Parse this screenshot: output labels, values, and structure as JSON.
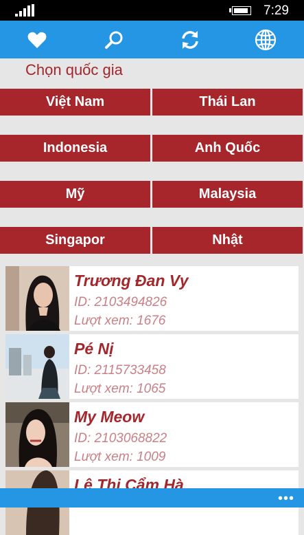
{
  "status": {
    "time": "7:29"
  },
  "appbar": {
    "icons": [
      "heart-icon",
      "search-icon",
      "refresh-icon",
      "globe-icon"
    ]
  },
  "heading": "Chọn quốc gia",
  "countries": [
    "Việt Nam",
    "Thái Lan",
    "Indonesia",
    "Anh Quốc",
    "Mỹ",
    "Malaysia",
    "Singapor",
    "Nhật"
  ],
  "profiles": [
    {
      "name": "Trương Đan Vy",
      "id": "ID:  2103494826",
      "views": "Lượt xem: 1676"
    },
    {
      "name": "Pé Nị",
      "id": "ID:  2115733458",
      "views": "Lượt xem: 1065"
    },
    {
      "name": "My Meow",
      "id": "ID:  2103068822",
      "views": "Lượt xem: 1009"
    },
    {
      "name": "Lê Thị Cẩm Hà",
      "id": "",
      "views": ""
    }
  ],
  "bottombar": {
    "more": "•••"
  },
  "colors": {
    "appbar": "#2596e4",
    "accent": "#a6262c",
    "muted_text": "#c98086",
    "background": "#e6e6e6"
  }
}
